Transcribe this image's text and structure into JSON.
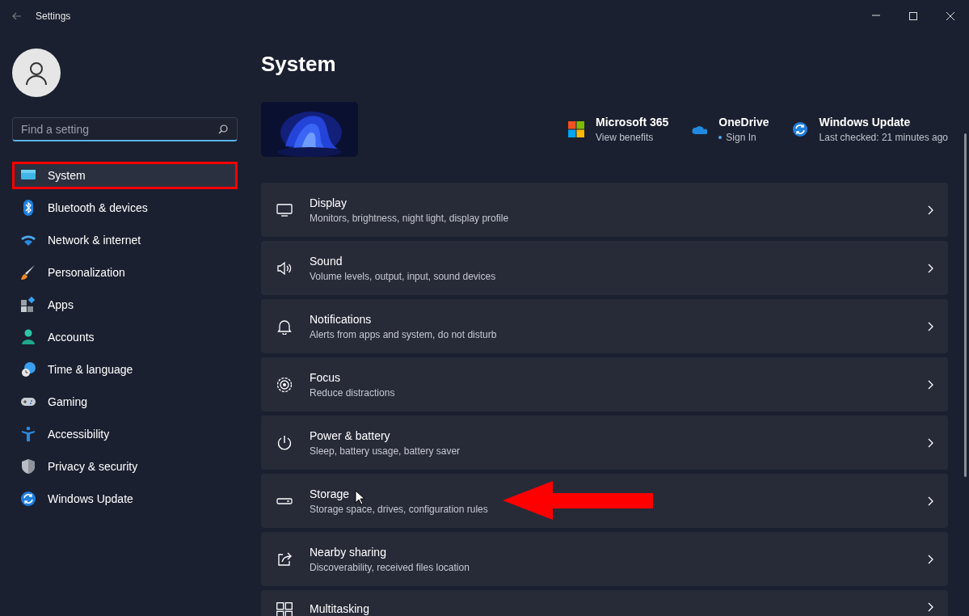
{
  "window": {
    "title": "Settings"
  },
  "sidebar": {
    "search": {
      "placeholder": "Find a setting"
    },
    "items": [
      {
        "label": "System",
        "selected": true,
        "highlighted": true
      },
      {
        "label": "Bluetooth & devices",
        "selected": false,
        "highlighted": false
      },
      {
        "label": "Network & internet",
        "selected": false,
        "highlighted": false
      },
      {
        "label": "Personalization",
        "selected": false,
        "highlighted": false
      },
      {
        "label": "Apps",
        "selected": false,
        "highlighted": false
      },
      {
        "label": "Accounts",
        "selected": false,
        "highlighted": false
      },
      {
        "label": "Time & language",
        "selected": false,
        "highlighted": false
      },
      {
        "label": "Gaming",
        "selected": false,
        "highlighted": false
      },
      {
        "label": "Accessibility",
        "selected": false,
        "highlighted": false
      },
      {
        "label": "Privacy & security",
        "selected": false,
        "highlighted": false
      },
      {
        "label": "Windows Update",
        "selected": false,
        "highlighted": false
      }
    ]
  },
  "page": {
    "title": "System",
    "services": [
      {
        "title": "Microsoft 365",
        "subtitle": "View benefits"
      },
      {
        "title": "OneDrive",
        "subtitle": "Sign In"
      },
      {
        "title": "Windows Update",
        "subtitle": "Last checked: 21 minutes ago"
      }
    ],
    "cards": [
      {
        "title": "Display",
        "subtitle": "Monitors, brightness, night light, display profile",
        "pointed": false
      },
      {
        "title": "Sound",
        "subtitle": "Volume levels, output, input, sound devices",
        "pointed": false
      },
      {
        "title": "Notifications",
        "subtitle": "Alerts from apps and system, do not disturb",
        "pointed": false
      },
      {
        "title": "Focus",
        "subtitle": "Reduce distractions",
        "pointed": false
      },
      {
        "title": "Power & battery",
        "subtitle": "Sleep, battery usage, battery saver",
        "pointed": false
      },
      {
        "title": "Storage",
        "subtitle": "Storage space, drives, configuration rules",
        "pointed": true
      },
      {
        "title": "Nearby sharing",
        "subtitle": "Discoverability, received files location",
        "pointed": false
      },
      {
        "title": "Multitasking",
        "pointed": false
      }
    ]
  }
}
